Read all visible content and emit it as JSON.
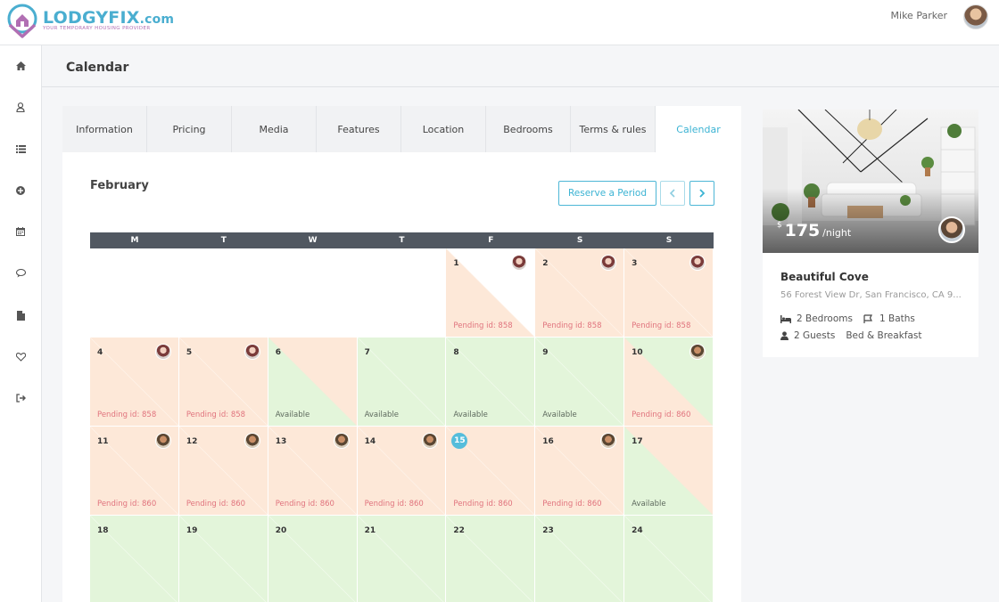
{
  "brand": {
    "name": "LODGYFIX",
    "suffix": ".com",
    "tagline": "YOUR TEMPORARY HOUSING PROVIDER"
  },
  "user": {
    "name": "Mike Parker"
  },
  "sidebar": [
    {
      "icon": "home-icon"
    },
    {
      "icon": "user-icon"
    },
    {
      "icon": "list-icon"
    },
    {
      "icon": "plus-circle-icon"
    },
    {
      "icon": "calendar-icon"
    },
    {
      "icon": "chat-icon"
    },
    {
      "icon": "document-icon"
    },
    {
      "icon": "heart-icon"
    },
    {
      "icon": "logout-icon"
    }
  ],
  "page": {
    "title": "Calendar"
  },
  "tabs": [
    "Information",
    "Pricing",
    "Media",
    "Features",
    "Location",
    "Bedrooms",
    "Terms & rules",
    "Calendar"
  ],
  "active_tab": "Calendar",
  "calendar": {
    "month": "February",
    "reserve_label": "Reserve a Period",
    "prev_icon": "chevron-left-icon",
    "next_icon": "chevron-right-icon",
    "weekdays": [
      "M",
      "T",
      "W",
      "T",
      "F",
      "S",
      "S"
    ],
    "days": [
      {
        "day": "1",
        "status": "Pending id: 858"
      },
      {
        "day": "2",
        "status": "Pending id: 858"
      },
      {
        "day": "3",
        "status": "Pending id: 858"
      },
      {
        "day": "4",
        "status": "Pending id: 858"
      },
      {
        "day": "5",
        "status": "Pending id: 858"
      },
      {
        "day": "6",
        "status": "Available"
      },
      {
        "day": "7",
        "status": "Available"
      },
      {
        "day": "8",
        "status": "Available"
      },
      {
        "day": "9",
        "status": "Available"
      },
      {
        "day": "10",
        "status": "Pending id: 860"
      },
      {
        "day": "11",
        "status": "Pending id: 860"
      },
      {
        "day": "12",
        "status": "Pending id: 860"
      },
      {
        "day": "13",
        "status": "Pending id: 860"
      },
      {
        "day": "14",
        "status": "Pending id: 860"
      },
      {
        "day": "15",
        "status": "Pending id: 860"
      },
      {
        "day": "16",
        "status": "Pending id: 860"
      },
      {
        "day": "17",
        "status": "Available"
      },
      {
        "day": "18",
        "status": ""
      },
      {
        "day": "19",
        "status": ""
      },
      {
        "day": "20",
        "status": ""
      },
      {
        "day": "21",
        "status": ""
      },
      {
        "day": "22",
        "status": ""
      },
      {
        "day": "23",
        "status": ""
      },
      {
        "day": "24",
        "status": ""
      }
    ]
  },
  "listing": {
    "currency": "$",
    "price": "175",
    "per": "/night",
    "name": "Beautiful Cove",
    "address": "56 Forest View Dr, San Francisco, CA 9...",
    "bedrooms": "2 Bedrooms",
    "baths": "1 Baths",
    "guests": "2 Guests",
    "type": "Bed & Breakfast"
  }
}
